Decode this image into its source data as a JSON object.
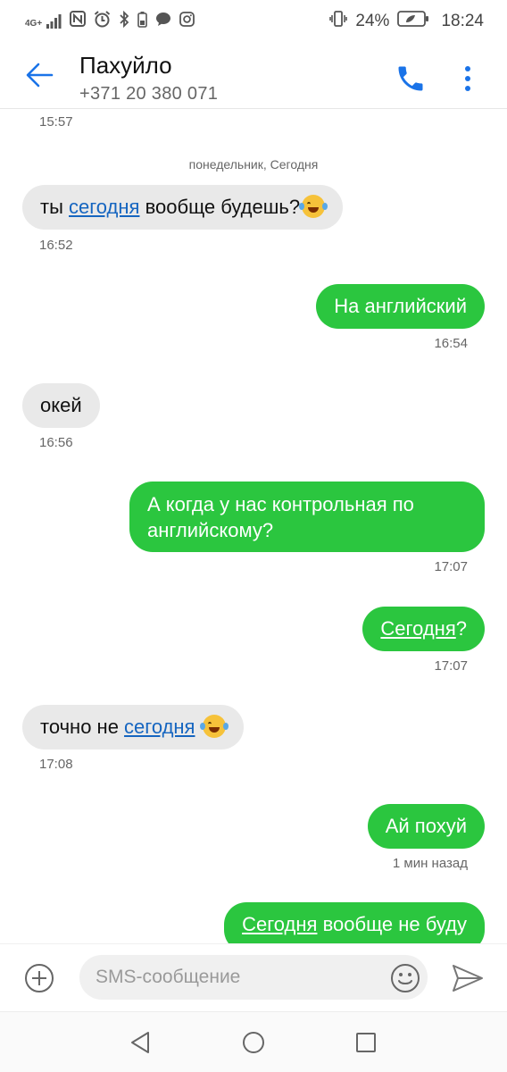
{
  "status_bar": {
    "network": "4G+",
    "battery_percent": "24%",
    "time": "18:24",
    "icons": [
      "signal-icon",
      "nfc-icon",
      "alarm-icon",
      "bluetooth-icon",
      "battery-saver-icon",
      "chat-icon",
      "instagram-icon",
      "vibrate-icon",
      "battery-icon"
    ]
  },
  "header": {
    "contact_name": "Пахуйло",
    "contact_number": "+371 20 380 071",
    "accent_color": "#1a73e8"
  },
  "conversation": {
    "top_time": "15:57",
    "date_separator": "понедельник, Сегодня",
    "messages": [
      {
        "direction": "incoming",
        "parts": [
          "ты ",
          "сегодня",
          " вообще будешь?"
        ],
        "emoji": "face-with-tears-of-joy",
        "time": "16:52"
      },
      {
        "direction": "outgoing",
        "text": "На английский",
        "time": "16:54"
      },
      {
        "direction": "incoming",
        "text": "окей",
        "time": "16:56"
      },
      {
        "direction": "outgoing",
        "line1": "А когда у нас контрольная по",
        "line2": "английскому?",
        "time": "17:07"
      },
      {
        "direction": "outgoing",
        "parts": [
          "Сегодня",
          "?"
        ],
        "time": "17:07"
      },
      {
        "direction": "incoming",
        "parts": [
          "точно не ",
          "сегодня"
        ],
        "emoji": "face-with-tears-of-joy",
        "time": "17:08"
      },
      {
        "direction": "outgoing",
        "text": "Ай похуй",
        "time": "1 мин назад"
      },
      {
        "direction": "outgoing",
        "parts": [
          "Сегодня",
          " вообще не буду"
        ]
      }
    ],
    "incoming_color": "#e9e9e9",
    "outgoing_color": "#2bc63f"
  },
  "compose": {
    "placeholder": "SMS-сообщение"
  },
  "navbar": {
    "icons": [
      "nav-back-icon",
      "nav-home-icon",
      "nav-recent-apps-icon"
    ]
  }
}
